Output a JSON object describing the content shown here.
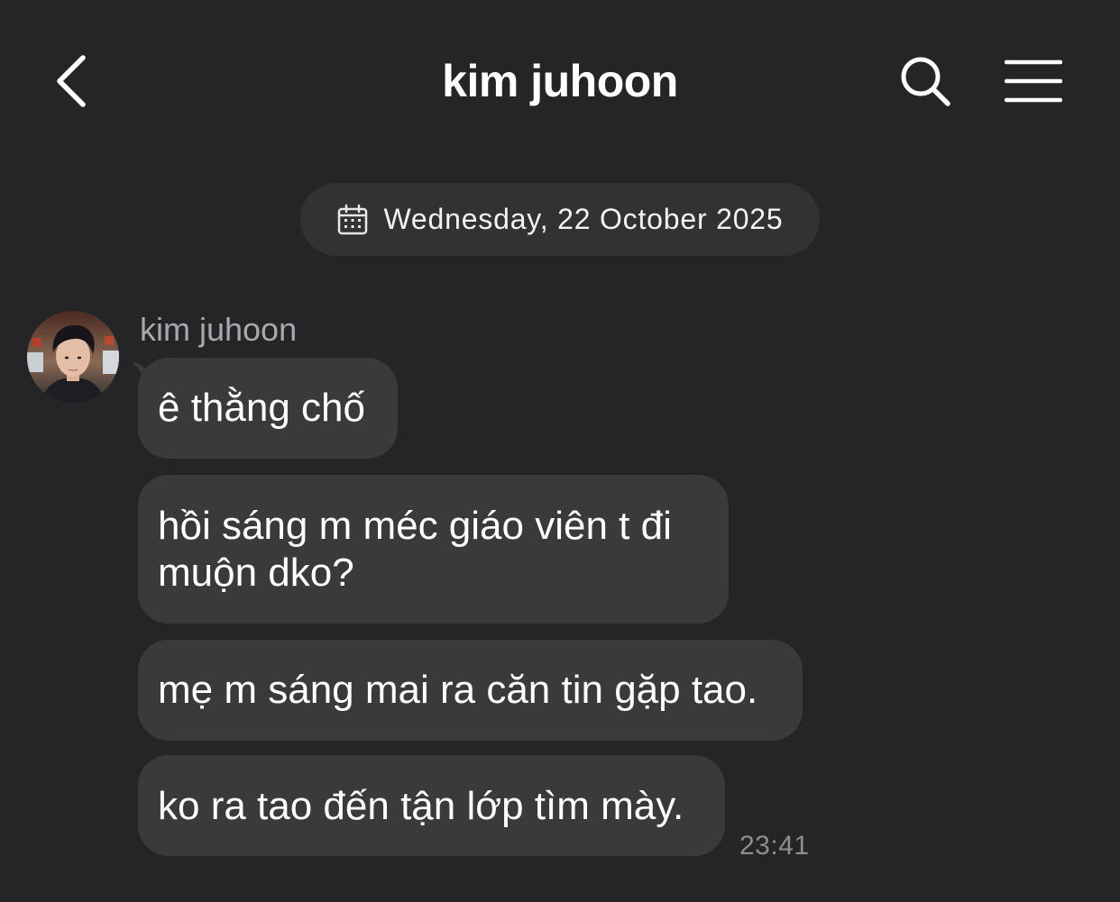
{
  "header": {
    "title": "kim juhoon",
    "back_icon": "chevron-left-icon",
    "search_icon": "search-icon",
    "menu_icon": "hamburger-menu-icon"
  },
  "date_separator": {
    "icon": "calendar-icon",
    "text": "Wednesday, 22 October 2025"
  },
  "sender": {
    "name": "kim juhoon",
    "avatar": "avatar-photo"
  },
  "messages": [
    {
      "text": "ê thằng chố"
    },
    {
      "text": "hồi sáng m méc giáo viên t đi muộn dko?"
    },
    {
      "text": "mẹ m sáng mai ra căn tin gặp tao."
    },
    {
      "text": "ko ra tao đến tận lớp tìm mày."
    }
  ],
  "last_timestamp": "23:41",
  "colors": {
    "background": "#252527",
    "bubble": "#3a3a3d",
    "pill": "#323235",
    "secondary_text": "#8e8e93"
  }
}
